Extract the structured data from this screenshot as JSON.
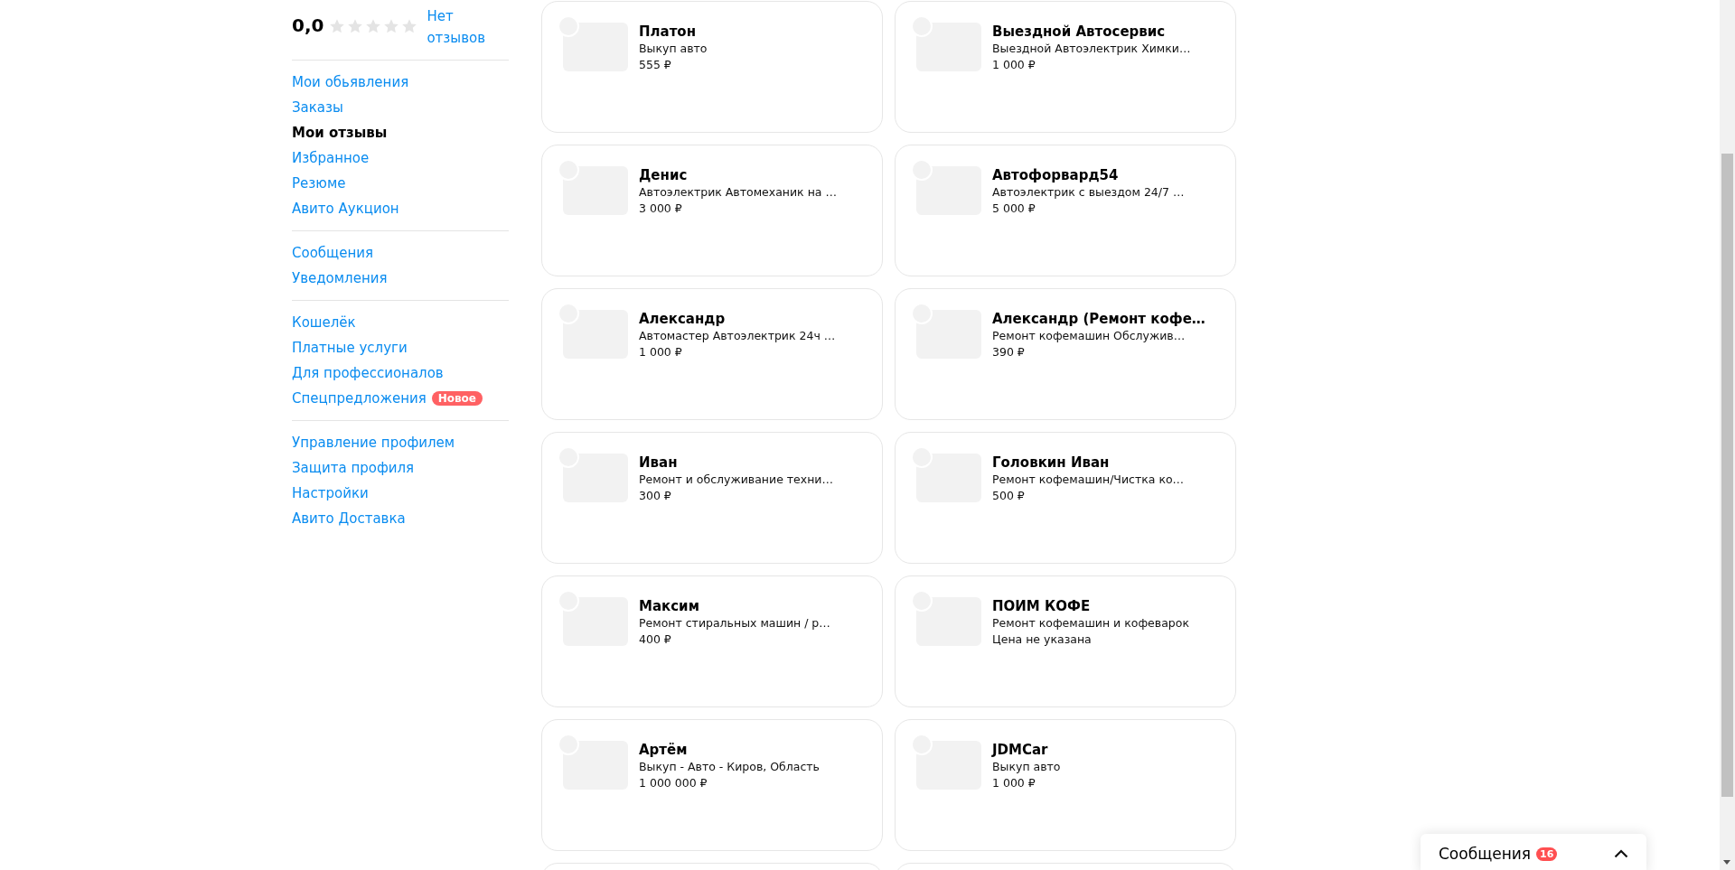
{
  "rating": {
    "value": "0,0",
    "stars": 0,
    "reviews_link": "Нет отзывов"
  },
  "menu_groups": [
    [
      {
        "label": "Мои обьявления",
        "selected": false
      },
      {
        "label": "Заказы",
        "selected": false
      },
      {
        "label": "Мои отзывы",
        "selected": true
      },
      {
        "label": "Избранное",
        "selected": false
      },
      {
        "label": "Резюме",
        "selected": false
      },
      {
        "label": "Авито Аукцион",
        "selected": false
      }
    ],
    [
      {
        "label": "Сообщения",
        "selected": false
      },
      {
        "label": "Уведомления",
        "selected": false
      }
    ],
    [
      {
        "label": "Кошелёк",
        "selected": false
      },
      {
        "label": "Платные услуги",
        "selected": false
      },
      {
        "label": "Для профессионалов",
        "selected": false
      },
      {
        "label": "Спецпредложения",
        "selected": false,
        "badge": "Новое"
      }
    ],
    [
      {
        "label": "Управление профилем",
        "selected": false
      },
      {
        "label": "Защита профиля",
        "selected": false
      },
      {
        "label": "Настройки",
        "selected": false
      },
      {
        "label": "Авито Доставка",
        "selected": false
      }
    ]
  ],
  "cards": [
    {
      "kind": "listing",
      "name": "Платон",
      "description": "Выкуп авто",
      "price": "555 ₽"
    },
    {
      "kind": "listing",
      "name": "Выездной Автосервис",
      "description": "Выездной Автоэлектрик Химки…",
      "price": "1 000 ₽"
    },
    {
      "kind": "listing",
      "name": "Денис",
      "description": "Автоэлектрик Автомеханик на …",
      "price": "3 000 ₽"
    },
    {
      "kind": "listing",
      "name": "Автофорвард54",
      "description": "Автоэлектрик с выездом 24/7 …",
      "price": "5 000 ₽"
    },
    {
      "kind": "listing",
      "name": "Александр",
      "description": "Автомастер Автоэлектрик 24ч …",
      "price": "1 000 ₽"
    },
    {
      "kind": "listing",
      "name": "Александр (Ремонт кофе…",
      "description": "Ремонт кофемашин Обслужив…",
      "price": "390 ₽"
    },
    {
      "kind": "listing",
      "name": "Иван",
      "description": "Ремонт и обслуживание техни…",
      "price": "300 ₽"
    },
    {
      "kind": "listing",
      "name": "Головкин Иван",
      "description": "Ремонт кофемашин/Чистка ко…",
      "price": "500 ₽"
    },
    {
      "kind": "listing",
      "name": "Максим",
      "description": "Ремонт стиральных машин / р…",
      "price": "400 ₽"
    },
    {
      "kind": "listing",
      "name": "ПОИМ КОФЕ",
      "description": "Ремонт кофемашин и кофеварок",
      "price": "Цена не указана"
    },
    {
      "kind": "listing",
      "name": "Артём",
      "description": "Выкуп - Авто - Киров, Область",
      "price": "1 000 000 ₽"
    },
    {
      "kind": "listing",
      "name": "JDMCar",
      "description": "Выкуп авто",
      "price": "1 000 ₽"
    },
    {
      "kind": "cut"
    },
    {
      "kind": "cut"
    }
  ],
  "messages_widget": {
    "label": "Сообщения",
    "count": "16",
    "expanded": false
  }
}
